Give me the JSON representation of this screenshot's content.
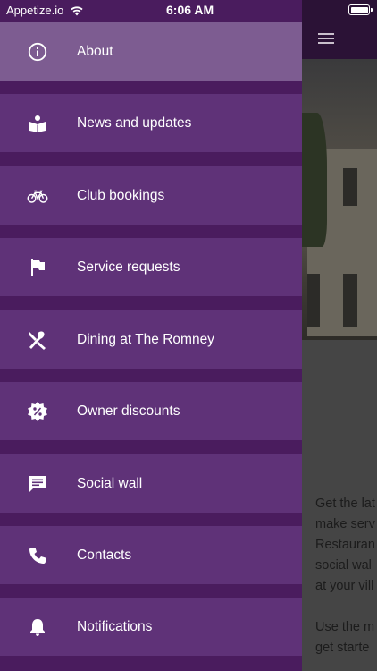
{
  "status_bar": {
    "carrier": "Appetize.io",
    "time": "6:06 AM"
  },
  "drawer": {
    "items": [
      {
        "label": "About",
        "icon": "info-icon",
        "active": true
      },
      {
        "label": "News and updates",
        "icon": "reading-icon"
      },
      {
        "label": "Club bookings",
        "icon": "bicycle-icon"
      },
      {
        "label": "Service requests",
        "icon": "flag-icon"
      },
      {
        "label": "Dining at The Romney",
        "icon": "utensils-icon"
      },
      {
        "label": "Owner discounts",
        "icon": "discount-badge-icon"
      },
      {
        "label": "Social wall",
        "icon": "chat-icon"
      },
      {
        "label": "Contacts",
        "icon": "phone-icon"
      },
      {
        "label": "Notifications",
        "icon": "bell-icon"
      }
    ]
  },
  "main": {
    "paragraph1_lines": [
      "Get the lat",
      "make serv",
      "Restauran",
      "social wal",
      "at your vill"
    ],
    "paragraph2_lines": [
      "Use the m",
      "get starte"
    ]
  },
  "colors": {
    "drawer_background": "#4a1c5e",
    "menu_item": "#5f3278",
    "menu_item_active": "#7d5c91",
    "main_header": "#2b1236"
  }
}
